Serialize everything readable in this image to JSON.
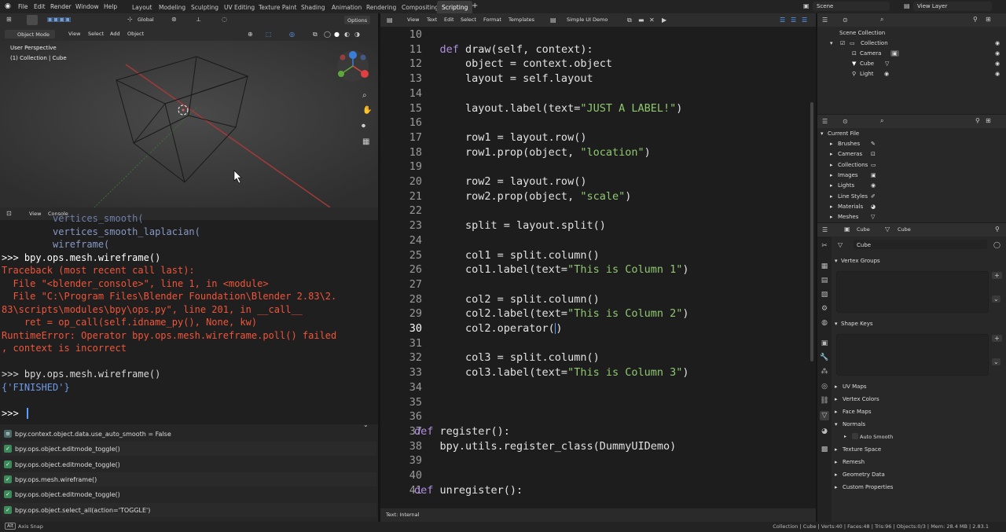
{
  "topbar": {
    "menus": [
      "File",
      "Edit",
      "Render",
      "Window",
      "Help"
    ],
    "workspaces": [
      "Layout",
      "Modeling",
      "Sculpting",
      "UV Editing",
      "Texture Paint",
      "Shading",
      "Animation",
      "Rendering",
      "Compositing",
      "Scripting"
    ],
    "active_workspace": "Scripting",
    "add_tab": "+",
    "scene": "Scene",
    "view_layer": "View Layer"
  },
  "viewport": {
    "mode": "Object Mode",
    "menus": [
      "View",
      "Select",
      "Add",
      "Object"
    ],
    "orientation": "Global",
    "options": "Options",
    "view_name": "User Perspective",
    "collection_info": "(1) Collection | Cube",
    "gizmo_colors": {
      "x": "#e04040",
      "y": "#5fa83a",
      "z": "#3b7ed8"
    }
  },
  "console": {
    "header_menus": [
      "View",
      "Console"
    ],
    "lines": [
      {
        "text": "         vertices_smooth(",
        "color": "#6d7fa8"
      },
      {
        "text": "         vertices_smooth_laplacian(",
        "color": "#8899c6"
      },
      {
        "text": "         wireframe(",
        "color": "#8899c6"
      },
      {
        "text": ">>> bpy.ops.mesh.wireframe()",
        "color": "#ffffff"
      },
      {
        "text": "Traceback (most recent call last):",
        "color": "#f0553a"
      },
      {
        "text": "  File \"<blender_console>\", line 1, in <module>",
        "color": "#f0553a"
      },
      {
        "text": "  File \"C:\\Program Files\\Blender Foundation\\Blender 2.83\\2.",
        "color": "#f0553a"
      },
      {
        "text": "83\\scripts\\modules\\bpy\\ops.py\", line 201, in __call__",
        "color": "#f0553a"
      },
      {
        "text": "    ret = op_call(self.idname_py(), None, kw)",
        "color": "#f0553a"
      },
      {
        "text": "RuntimeError: Operator bpy.ops.mesh.wireframe.poll() failed",
        "color": "#f0553a"
      },
      {
        "text": ", context is incorrect",
        "color": "#f0553a"
      },
      {
        "text": "",
        "color": "#ffffff"
      },
      {
        "text": ">>> bpy.ops.mesh.wireframe()",
        "color": "#d8d8d8"
      },
      {
        "text": "{'FINISHED'}",
        "color": "#6f9ae8"
      },
      {
        "text": "",
        "color": "#ffffff"
      },
      {
        "text": ">>> ",
        "color": "#ffffff"
      }
    ]
  },
  "info_log": [
    "bpy.context.object.data.use_auto_smooth = False",
    "bpy.ops.object.editmode_toggle()",
    "bpy.ops.object.editmode_toggle()",
    "bpy.ops.mesh.wireframe()",
    "bpy.ops.object.editmode_toggle()",
    "bpy.ops.object.select_all(action='TOGGLE')"
  ],
  "text_editor": {
    "menus": [
      "View",
      "Text",
      "Edit",
      "Select",
      "Format",
      "Templates"
    ],
    "file_name": "Simple UI Demo",
    "footer": "Text: Internal",
    "current_line": "30",
    "lines": [
      {
        "n": "10",
        "html": ""
      },
      {
        "n": "11",
        "html": "    <span class=\"kw\">def</span> draw(self, context):"
      },
      {
        "n": "12",
        "html": "        object = context.object"
      },
      {
        "n": "13",
        "html": "        layout = self.layout"
      },
      {
        "n": "14",
        "html": ""
      },
      {
        "n": "15",
        "html": "        layout.label(text=<span class=\"str\">\"JUST A LABEL!\"</span>)"
      },
      {
        "n": "16",
        "html": ""
      },
      {
        "n": "17",
        "html": "        row1 = layout.row()"
      },
      {
        "n": "18",
        "html": "        row1.prop(object, <span class=\"str\">\"location\"</span>)"
      },
      {
        "n": "19",
        "html": ""
      },
      {
        "n": "20",
        "html": "        row2 = layout.row()"
      },
      {
        "n": "21",
        "html": "        row2.prop(object, <span class=\"str\">\"scale\"</span>)"
      },
      {
        "n": "22",
        "html": ""
      },
      {
        "n": "23",
        "html": "        split = layout.split()"
      },
      {
        "n": "24",
        "html": ""
      },
      {
        "n": "25",
        "html": "        col1 = split.column()"
      },
      {
        "n": "26",
        "html": "        col1.label(text=<span class=\"str\">\"This is Column 1\"</span>)"
      },
      {
        "n": "27",
        "html": ""
      },
      {
        "n": "28",
        "html": "        col2 = split.column()"
      },
      {
        "n": "29",
        "html": "        col2.label(text=<span class=\"str\">\"This is Column 2\"</span>)"
      },
      {
        "n": "30",
        "html": "        col2.operator(<span class=\"cursor\"></span>)"
      },
      {
        "n": "31",
        "html": ""
      },
      {
        "n": "32",
        "html": "        col3 = split.column()"
      },
      {
        "n": "33",
        "html": "        col3.label(text=<span class=\"str\">\"This is Column 3\"</span>)"
      },
      {
        "n": "34",
        "html": ""
      },
      {
        "n": "35",
        "html": ""
      },
      {
        "n": "36",
        "html": ""
      },
      {
        "n": "37",
        "html": "<span class=\"kw\">def</span> register():"
      },
      {
        "n": "38",
        "html": "    bpy.utils.register_class(DummyUIDemo)"
      },
      {
        "n": "39",
        "html": ""
      },
      {
        "n": "40",
        "html": ""
      },
      {
        "n": "41",
        "html": "<span class=\"kw\">def</span> unregister():"
      }
    ]
  },
  "outliner": {
    "items": [
      {
        "label": "Scene Collection"
      },
      {
        "label": "Collection"
      },
      {
        "label": "Camera"
      },
      {
        "label": "Cube"
      },
      {
        "label": "Light"
      }
    ]
  },
  "data_browser": {
    "root": "Current File",
    "items": [
      "Brushes",
      "Cameras",
      "Collections",
      "Images",
      "Lights",
      "Line Styles",
      "Materials",
      "Meshes"
    ]
  },
  "properties": {
    "breadcrumb": [
      "Cube",
      "Cube"
    ],
    "mesh_name": "Cube",
    "sections": {
      "vertex_groups": "Vertex Groups",
      "shape_keys": "Shape Keys",
      "uv_maps": "UV Maps",
      "vertex_colors": "Vertex Colors",
      "face_maps": "Face Maps",
      "normals": "Normals",
      "auto_smooth": "Auto Smooth",
      "texture_space": "Texture Space",
      "remesh": "Remesh",
      "geometry_data": "Geometry Data",
      "custom_properties": "Custom Properties"
    }
  },
  "statusbar": {
    "left": "Axis Snap",
    "right": "Collection | Cube | Verts:40 | Faces:48 | Tris:96 | Objects:0/3 | Mem: 28.4 MB | 2.83.1"
  }
}
